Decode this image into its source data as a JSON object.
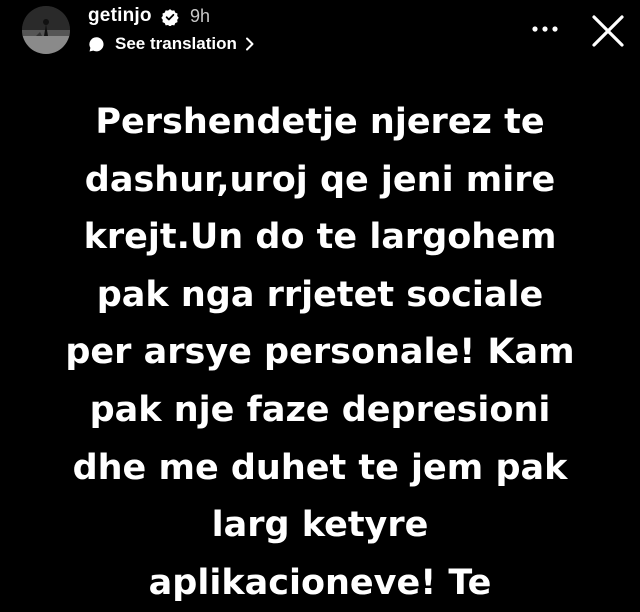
{
  "header": {
    "username": "getinjo",
    "time_ago": "9h",
    "translate_label": "See translation",
    "avatar_icon": "profile-avatar-icon",
    "verified_icon": "verified-badge-icon",
    "translate_icon": "speech-bubble-icon",
    "chevron_icon": "chevron-right-icon",
    "more_icon": "more-options-icon",
    "close_icon": "close-icon"
  },
  "story": {
    "lines": [
      "Pershendetje njerez te",
      "dashur,uroj qe jeni mire",
      "krejt.Un do te largohem",
      "pak nga rrjetet sociale",
      "per arsye personale! Kam",
      "pak nje faze depresioni",
      "dhe me duhet te jem pak",
      "larg ketyre",
      "aplikacioneve! Te"
    ]
  },
  "colors": {
    "background": "#000000",
    "text": "#ffffff",
    "muted_text": "#c8c8c8"
  }
}
